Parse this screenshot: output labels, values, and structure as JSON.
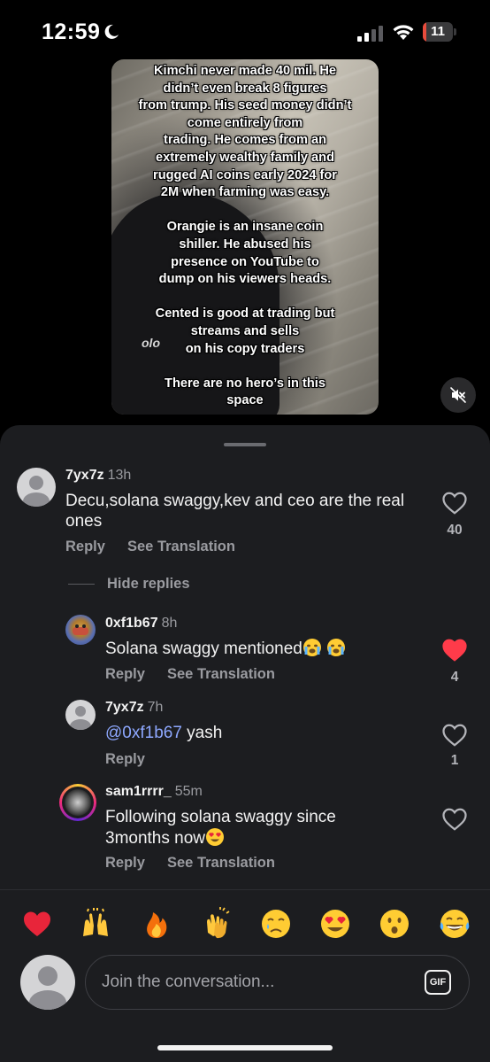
{
  "status_bar": {
    "time": "12:59",
    "battery": "11",
    "battery_level_percent": 11,
    "icons": [
      "moon-icon",
      "signal-icon",
      "wifi-icon",
      "battery-icon"
    ]
  },
  "video": {
    "caption_paragraphs": [
      [
        "Kimchi never made 40 mil. He",
        "didn’t even break 8 figures",
        "from trump. His seed money didn’t",
        "come entirely from",
        "trading. He comes from an",
        "extremely wealthy family and",
        "rugged AI coins early 2024 for",
        "2M when farming was easy."
      ],
      [
        "Orangie is an insane coin",
        "shiller. He abused his",
        "presence on YouTube to",
        "dump on his viewers heads."
      ],
      [
        "Cented is good at trading but",
        "streams and sells",
        "on his copy traders"
      ],
      [
        "There are no hero’s in this",
        "space"
      ]
    ],
    "logo_text": "olo"
  },
  "comments": [
    {
      "username": "7yx7z",
      "time": "13h",
      "text": "Decu,solana swaggy,kev and ceo are the real ones",
      "reply_label": "Reply",
      "translate_label": "See Translation",
      "like_count": "40",
      "liked": false
    }
  ],
  "hide_replies_label": "Hide replies",
  "replies": [
    {
      "username": "0xf1b67",
      "time": "8h",
      "text": "Solana swaggy mentioned",
      "reply_label": "Reply",
      "translate_label": "See Translation",
      "like_count": "4",
      "liked": true
    },
    {
      "username": "7yx7z",
      "time": "7h",
      "mention": "@0xf1b67",
      "text": " yash",
      "reply_label": "Reply",
      "like_count": "1",
      "liked": false
    },
    {
      "username": "sam1rrrr_",
      "time": "55m",
      "text_line1": "Following solana swaggy since",
      "text_line2": "3months now",
      "reply_label": "Reply",
      "translate_label": "See Translation",
      "liked": false
    }
  ],
  "reactions": [
    "heart-emoji",
    "raised-hands-emoji",
    "fire-emoji",
    "clapping-emoji",
    "crying-emoji",
    "heart-eyes-emoji",
    "surprised-emoji",
    "tears-of-joy-emoji"
  ],
  "composer": {
    "placeholder": "Join the conversation...",
    "gif_label": "GIF"
  },
  "colors": {
    "sheet_background": "#1c1d20",
    "like_red": "#ff3b4a",
    "mention_blue": "#8ea8ff",
    "battery_red": "#e84b3c"
  }
}
